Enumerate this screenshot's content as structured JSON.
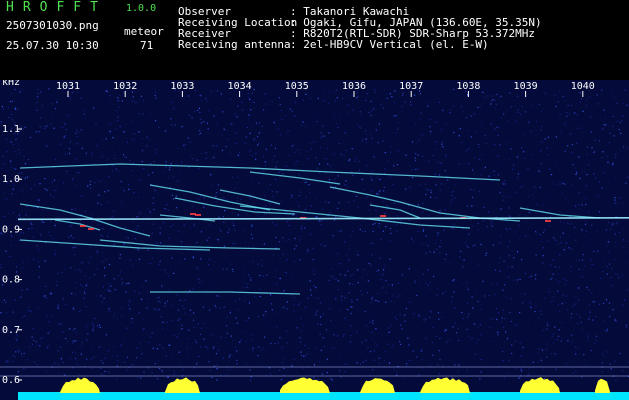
{
  "header": {
    "app_name": "HROFFT",
    "app_version": "1.0.0",
    "filename": "2507301030.png",
    "datetime": "25.07.30 10:30",
    "meteor_label": "meteor",
    "meteor_count": "71",
    "info": [
      {
        "label": "Observer",
        "sep": ":",
        "value": "Takanori Kawachi"
      },
      {
        "label": "Receiving Location",
        "sep": ":",
        "value": "Ogaki, Gifu, JAPAN (136.60E, 35.35N)"
      },
      {
        "label": "Receiver",
        "sep": ":",
        "value": "R820T2(RTL-SDR) SDR-Sharp 53.372MHz"
      },
      {
        "label": "Receiving antenna",
        "sep": ":",
        "value": "2el-HB9CV Vertical (el. E-W)"
      }
    ]
  },
  "spectrogram": {
    "y_unit": "kHz",
    "time_ticks": [
      "1031",
      "1032",
      "1033",
      "1034",
      "1035",
      "1036",
      "1037",
      "1038",
      "1039",
      "1040"
    ],
    "freq_ticks": [
      "1.1",
      "1.0",
      "0.9",
      "0.8",
      "0.7",
      "0.6"
    ],
    "freq_range_khz": [
      0.57,
      1.2
    ],
    "carrier_khz": 0.92,
    "colors": {
      "background": "#040a3a",
      "noise_low": "#1a2aa0",
      "noise_high": "#3a5cff",
      "trace": "#6cf0ff",
      "hot": "#ff4040",
      "carrier": "#9ff0ff",
      "signal_bar": "#ffff33",
      "baseline_bar": "#00e5ff"
    }
  }
}
